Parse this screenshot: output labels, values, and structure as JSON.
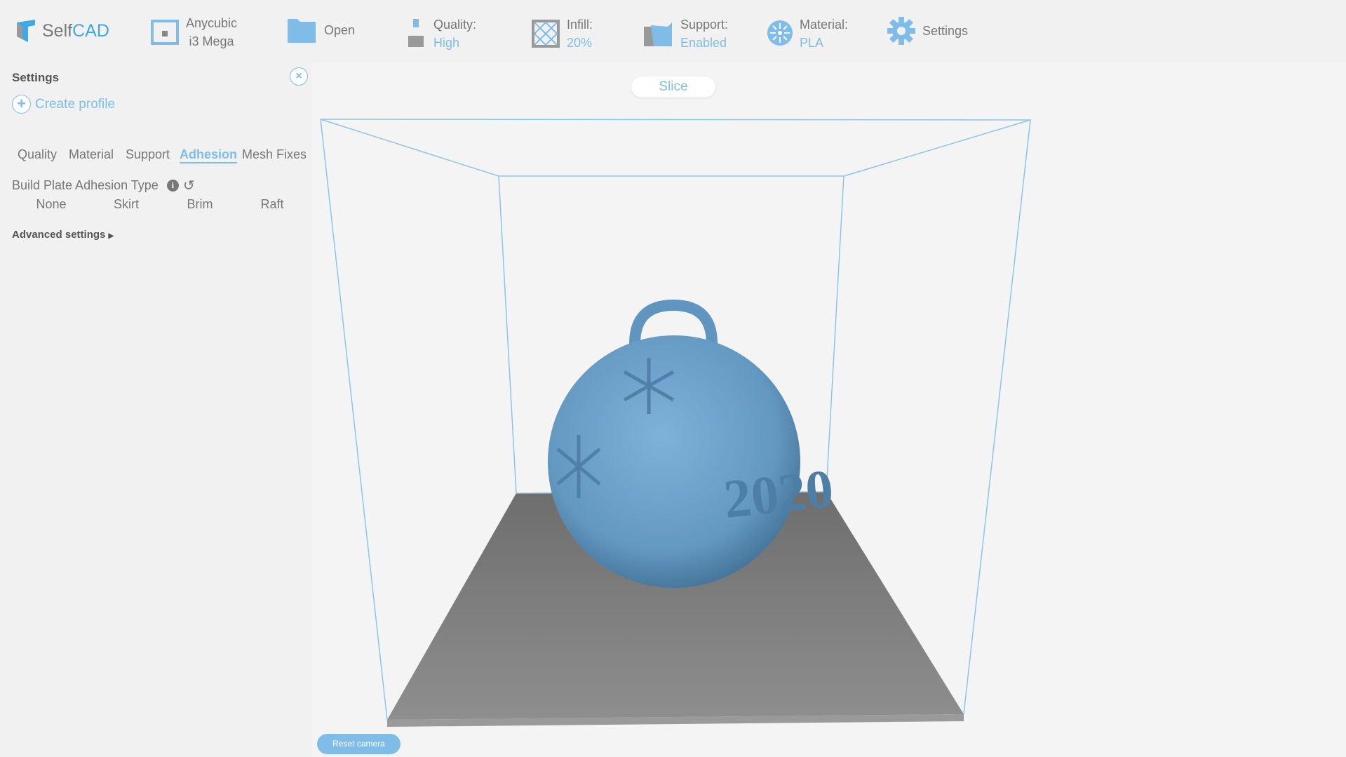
{
  "header": {
    "logo": {
      "part1": "Self",
      "part2": "CAD"
    },
    "printer": {
      "line1": "Anycubic",
      "line2": "i3 Mega",
      "icon": "printer-icon"
    },
    "open": {
      "label": "Open",
      "icon": "folder-icon"
    },
    "quality": {
      "label": "Quality:",
      "value": "High",
      "icon": "nozzle-icon"
    },
    "infill": {
      "label": "Infill:",
      "value": "20%",
      "icon": "infill-icon"
    },
    "support": {
      "label": "Support:",
      "value": "Enabled",
      "icon": "support-icon"
    },
    "material": {
      "label": "Material:",
      "value": "PLA",
      "icon": "filament-spool-icon"
    },
    "settings": {
      "label": "Settings",
      "icon": "gear-icon"
    }
  },
  "sidebar": {
    "title": "Settings",
    "create_profile": "Create profile",
    "tabs": [
      {
        "label": "Quality"
      },
      {
        "label": "Material"
      },
      {
        "label": "Support"
      },
      {
        "label": "Adhesion",
        "active": true
      },
      {
        "label": "Mesh Fixes"
      }
    ],
    "adhesion_type_label": "Build Plate Adhesion Type",
    "adhesion_options": [
      {
        "label": "None"
      },
      {
        "label": "Skirt"
      },
      {
        "label": "Brim",
        "selected": true
      },
      {
        "label": "Raft"
      }
    ],
    "advanced": "Advanced settings"
  },
  "viewport": {
    "slice": "Slice",
    "reset_camera": "Reset camera",
    "model_text": "2020"
  },
  "colors": {
    "accent": "#7fbde8",
    "model": "#6a9fc7",
    "plate": "#7d7d7d"
  }
}
